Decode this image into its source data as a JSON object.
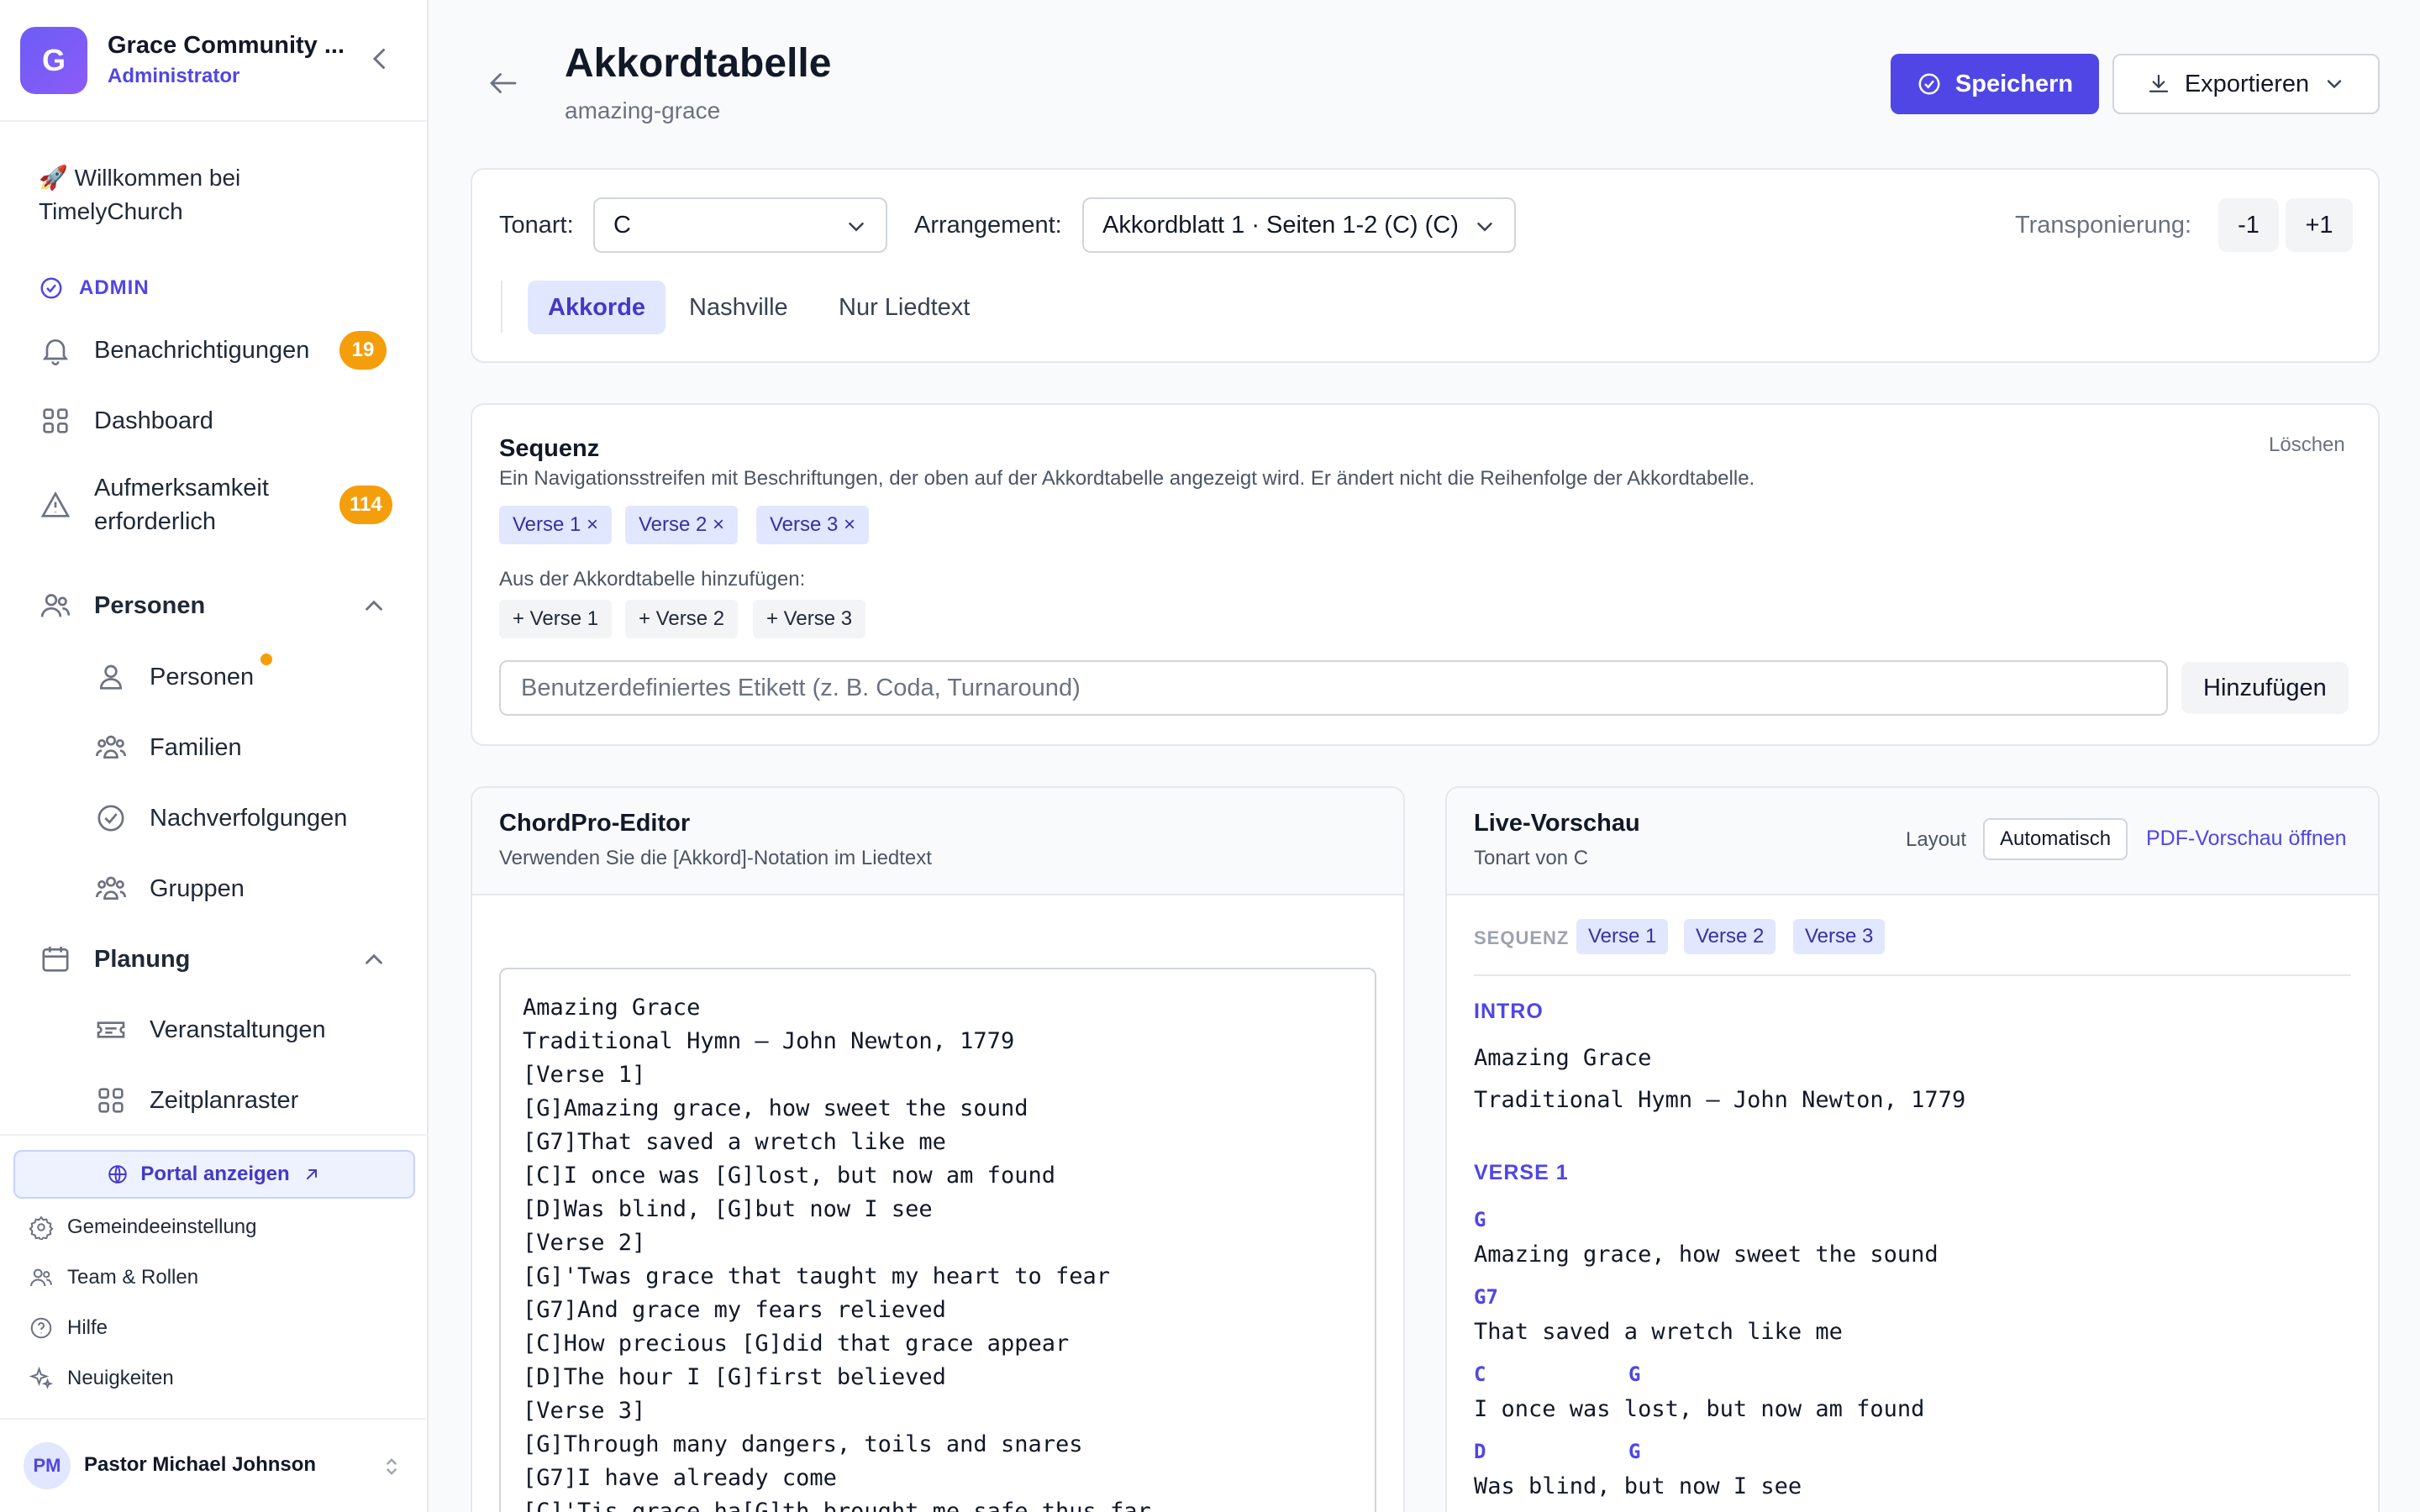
{
  "org": {
    "logo_letter": "G",
    "name": "Grace Community ...",
    "role": "Administrator"
  },
  "sidebar": {
    "welcome": "🚀 Willkommen bei TimelyChurch",
    "section_admin": "ADMIN",
    "notifications": {
      "label": "Benachrichtigungen",
      "count": "19"
    },
    "dashboard": "Dashboard",
    "attention": {
      "label": "Aufmerksamkeit erforderlich",
      "count": "114"
    },
    "people_group": "Personen",
    "people_items": [
      "Personen",
      "Familien",
      "Nachverfolgungen",
      "Gruppen"
    ],
    "planning_group": "Planung",
    "planning_items": [
      "Veranstaltungen",
      "Zeitplanraster"
    ],
    "portal_button": "Portal anzeigen",
    "footer_items": [
      "Gemeindeeinstellung",
      "Team & Rollen",
      "Hilfe",
      "Neuigkeiten"
    ],
    "user": {
      "initials": "PM",
      "name": "Pastor Michael Johnson"
    }
  },
  "header": {
    "title": "Akkordtabelle",
    "subtitle": "amazing-grace",
    "save_label": "Speichern",
    "export_label": "Exportieren"
  },
  "key_card": {
    "key_label": "Tonart:",
    "key_value": "C",
    "arrangement_label": "Arrangement:",
    "arrangement_value": "Akkordblatt 1 · Seiten 1-2 (C) (C)",
    "transpose_label": "Transponierung:",
    "transpose_minus": "-1",
    "transpose_plus": "+1",
    "tabs": [
      "Akkorde",
      "Nashville",
      "Nur Liedtext"
    ],
    "active_tab": "Akkorde"
  },
  "sequence": {
    "title": "Sequenz",
    "description": "Ein Navigationsstreifen mit Beschriftungen, der oben auf der Akkordtabelle angezeigt wird. Er ändert nicht die Reihenfolge der Akkordtabelle.",
    "clear_label": "Löschen",
    "chips": [
      "Verse 1 ×",
      "Verse 2 ×",
      "Verse 3 ×"
    ],
    "add_from_label": "Aus der Akkordtabelle hinzufügen:",
    "add_chips": [
      "+ Verse 1",
      "+ Verse 2",
      "+ Verse 3"
    ],
    "custom_placeholder": "Benutzerdefiniertes Etikett (z. B. Coda, Turnaround)",
    "add_button": "Hinzufügen"
  },
  "editor": {
    "title": "ChordPro-Editor",
    "subtitle": "Verwenden Sie die [Akkord]-Notation im Liedtext",
    "lines": [
      "Amazing Grace",
      "Traditional Hymn — John Newton, 1779",
      "[Verse 1]",
      "[G]Amazing grace, how sweet the sound",
      "[G7]That saved a wretch like me",
      "[C]I once was [G]lost, but now am found",
      "[D]Was blind, [G]but now I see",
      "[Verse 2]",
      "[G]'Twas grace that taught my heart to fear",
      "[G7]And grace my fears relieved",
      "[C]How precious [G]did that grace appear",
      "[D]The hour I [G]first believed",
      "[Verse 3]",
      "[G]Through many dangers, toils and snares",
      "[G7]I have already come",
      "[C]'Tis grace ha[G]th brought me safe thus far"
    ]
  },
  "preview": {
    "title": "Live-Vorschau",
    "subtitle": "Tonart von C",
    "layout_label": "Layout",
    "layout_value": "Automatisch",
    "pdf_link": "PDF-Vorschau öffnen",
    "sequence_label": "SEQUENZ",
    "sequence_chips": [
      "Verse 1",
      "Verse 2",
      "Verse 3"
    ],
    "intro_heading": "INTRO",
    "intro_lines": [
      "Amazing Grace",
      "Traditional Hymn — John Newton, 1779"
    ],
    "verse1_heading": "VERSE 1",
    "verse1": [
      {
        "chords": [
          "G"
        ],
        "text": "Amazing grace, how sweet the sound"
      },
      {
        "chords": [
          "G7"
        ],
        "text": "That saved a wretch like me"
      },
      {
        "chords": [
          "C",
          "G"
        ],
        "text": "I once was lost, but now am found"
      },
      {
        "chords": [
          "D",
          "G"
        ],
        "text": "Was blind, but now I see"
      }
    ]
  }
}
